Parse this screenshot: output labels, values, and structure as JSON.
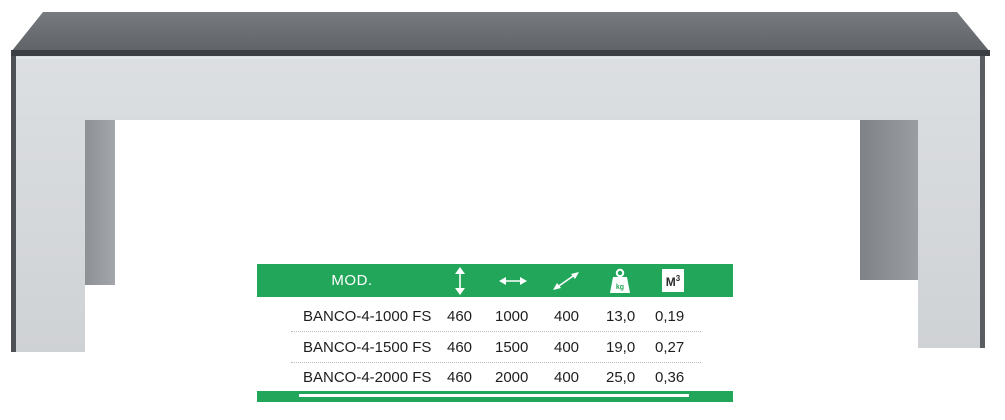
{
  "specs": {
    "header": {
      "model_label": "MOD.",
      "icons": [
        "height-icon",
        "length-icon",
        "depth-icon",
        "weight-icon",
        "volume-icon"
      ],
      "weight_icon_text": "kg",
      "volume_label": "M",
      "volume_superscript": "3"
    },
    "rows": [
      {
        "model": "BANCO-4-1000 FS",
        "height": "460",
        "length": "1000",
        "depth": "400",
        "weight": "13,0",
        "volume": "0,19"
      },
      {
        "model": "BANCO-4-1500 FS",
        "height": "460",
        "length": "1500",
        "depth": "400",
        "weight": "19,0",
        "volume": "0,27"
      },
      {
        "model": "BANCO-4-2000 FS",
        "height": "460",
        "length": "2000",
        "depth": "400",
        "weight": "25,0",
        "volume": "0,36"
      }
    ],
    "colors": {
      "accent": "#22a65a",
      "bench_top": "#6e7277",
      "bench_body": "#d4d7da"
    }
  }
}
